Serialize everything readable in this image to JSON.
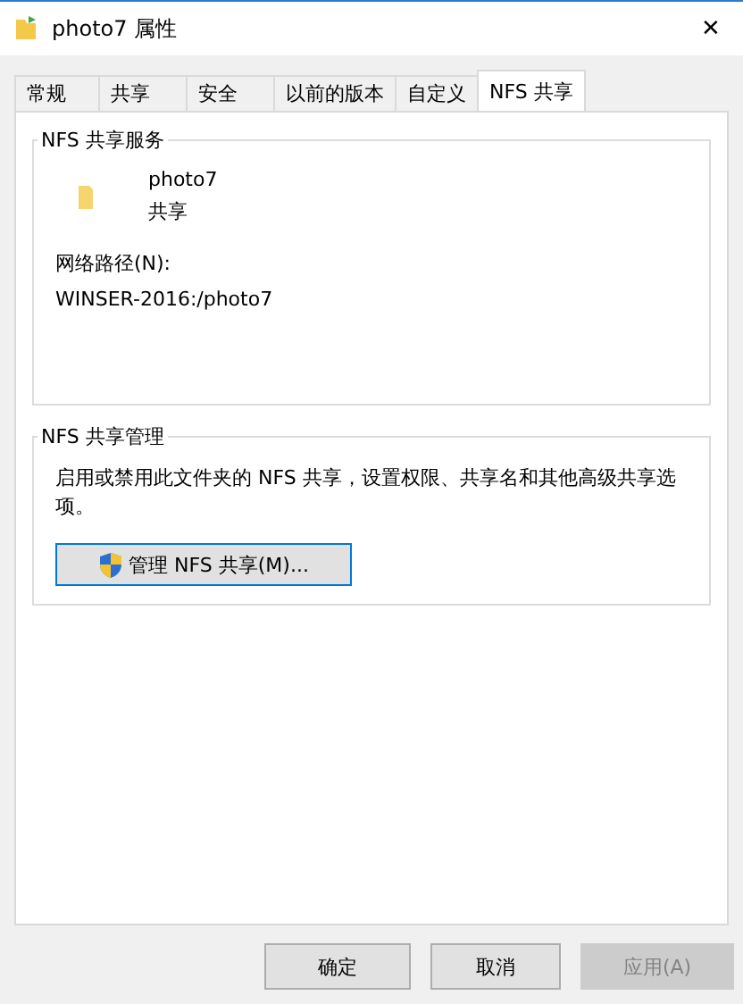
{
  "window": {
    "title": "photo7 属性",
    "close": "✕"
  },
  "tabs": [
    {
      "label": "常规",
      "selected": false
    },
    {
      "label": "共享",
      "selected": false
    },
    {
      "label": "安全",
      "selected": false
    },
    {
      "label": "以前的版本",
      "selected": false
    },
    {
      "label": "自定义",
      "selected": false
    },
    {
      "label": "NFS 共享",
      "selected": true
    }
  ],
  "service_group": {
    "title": "NFS 共享服务",
    "folder_name": "photo7",
    "folder_status": "共享",
    "path_label": "网络路径(N):",
    "path": "WINSER-2016:/photo7"
  },
  "manage_group": {
    "title": "NFS 共享管理",
    "description": "启用或禁用此文件夹的 NFS 共享，设置权限、共享名和其他高级共享选项。",
    "button": "管理 NFS 共享(M)..."
  },
  "buttons": [
    {
      "label": "确定",
      "disabled": false
    },
    {
      "label": "取消",
      "disabled": false
    },
    {
      "label": "应用(A)",
      "disabled": true
    }
  ]
}
